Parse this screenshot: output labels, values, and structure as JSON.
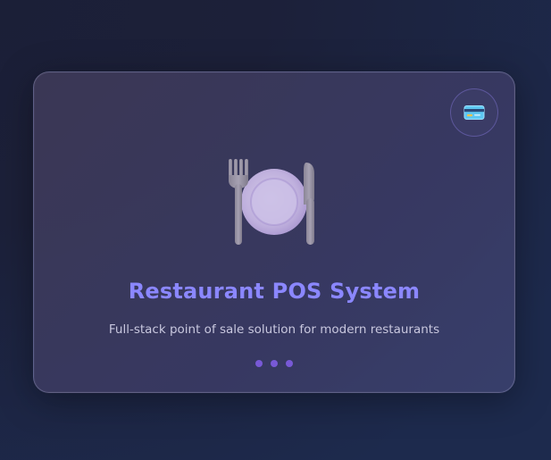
{
  "card": {
    "title": "Restaurant POS System",
    "subtitle": "Full-stack point of sale solution for modern restaurants",
    "hero_icon": "fork-plate-knife-icon",
    "badge_icon": "credit-card-icon",
    "pagination": {
      "count": 3,
      "active_index": 0
    }
  },
  "colors": {
    "title": "#8b87ff",
    "dots": "#7b5bdc",
    "accent": "#6c63ff"
  }
}
